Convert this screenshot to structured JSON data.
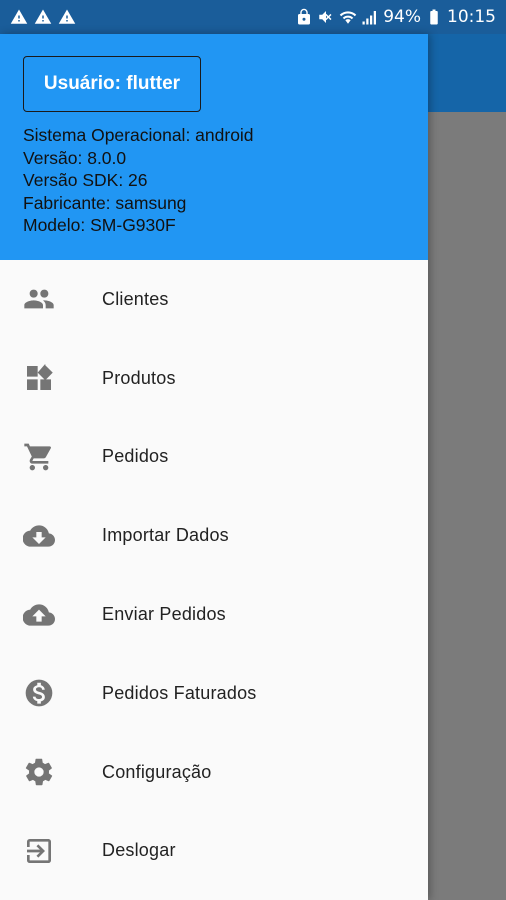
{
  "status_bar": {
    "battery_percent": "94%",
    "time": "10:15",
    "alert_icons": [
      "warning-icon",
      "warning-icon",
      "warning-icon"
    ]
  },
  "drawer": {
    "user_label": "Usuário: flutter",
    "device_info": [
      "Sistema Operacional: android",
      "Versão: 8.0.0",
      "Versão SDK: 26",
      "Fabricante: samsung",
      "Modelo: SM-G930F"
    ],
    "menu": [
      {
        "label": "Clientes",
        "icon": "people-icon"
      },
      {
        "label": "Produtos",
        "icon": "widgets-icon"
      },
      {
        "label": "Pedidos",
        "icon": "cart-icon"
      },
      {
        "label": "Importar Dados",
        "icon": "cloud-download-icon"
      },
      {
        "label": "Enviar Pedidos",
        "icon": "cloud-upload-icon"
      },
      {
        "label": "Pedidos Faturados",
        "icon": "dollar-icon"
      },
      {
        "label": "Configuração",
        "icon": "gear-icon"
      },
      {
        "label": "Deslogar",
        "icon": "logout-icon"
      }
    ]
  },
  "colors": {
    "header_bg": "#2196f3",
    "status_bar_bg": "#1a5d9a",
    "app_bar_bg": "#1565a8",
    "scrim": "#7a7a7a",
    "icon_gray": "#757575"
  }
}
